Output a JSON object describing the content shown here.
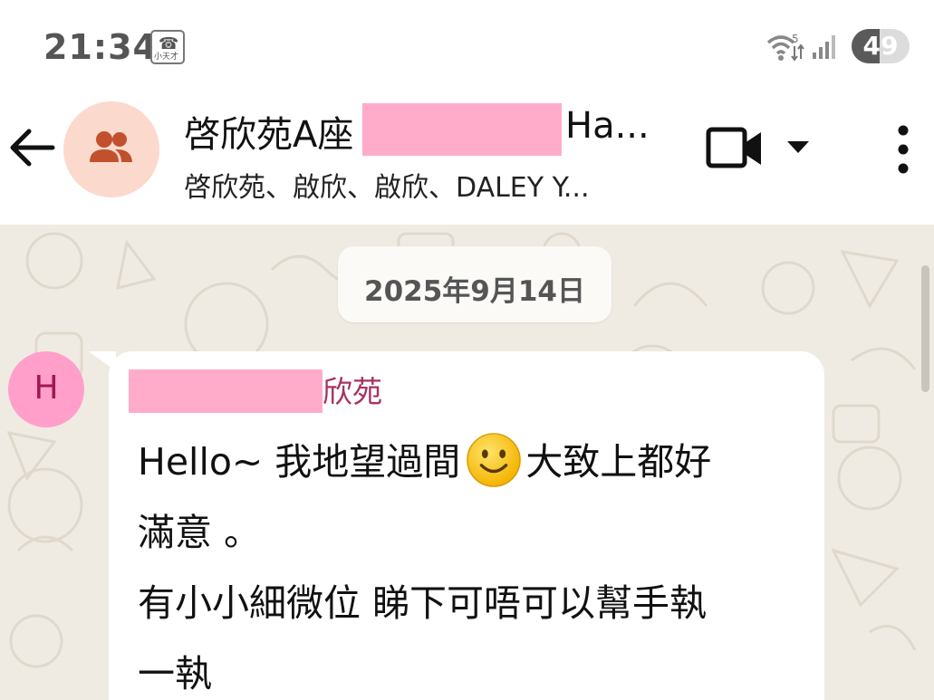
{
  "status_bar": {
    "time": "21:34",
    "app_badge_glyph": "☎",
    "app_badge_text": "小天才",
    "wifi_label": "5",
    "battery_level": "49"
  },
  "header": {
    "title_prefix": "啓欣苑A座",
    "title_suffix": "Ha...",
    "subtitle": "啓欣苑、啟欣、啟欣、DALEY Y...",
    "icons": [
      "back-arrow-icon",
      "group-icon",
      "video-call-icon",
      "dropdown-arrow-icon",
      "more-vertical-icon"
    ]
  },
  "chat": {
    "date": "2025年9月14日",
    "message": {
      "avatar_letter": "H",
      "sender_visible": "欣苑",
      "line1_a": "Hello~ 我地望過間",
      "line1_b": "大致上都好",
      "line2": "滿意 。",
      "line3": "有小小細微位 睇下可唔可以幫手執",
      "line4": "一執"
    }
  },
  "colors": {
    "chat_background": "#f0ebe2",
    "redaction": "#ffaccb",
    "sender_name": "#a83262",
    "avatar_pink": "#ff9fca",
    "group_avatar": "#fbd9cd"
  }
}
